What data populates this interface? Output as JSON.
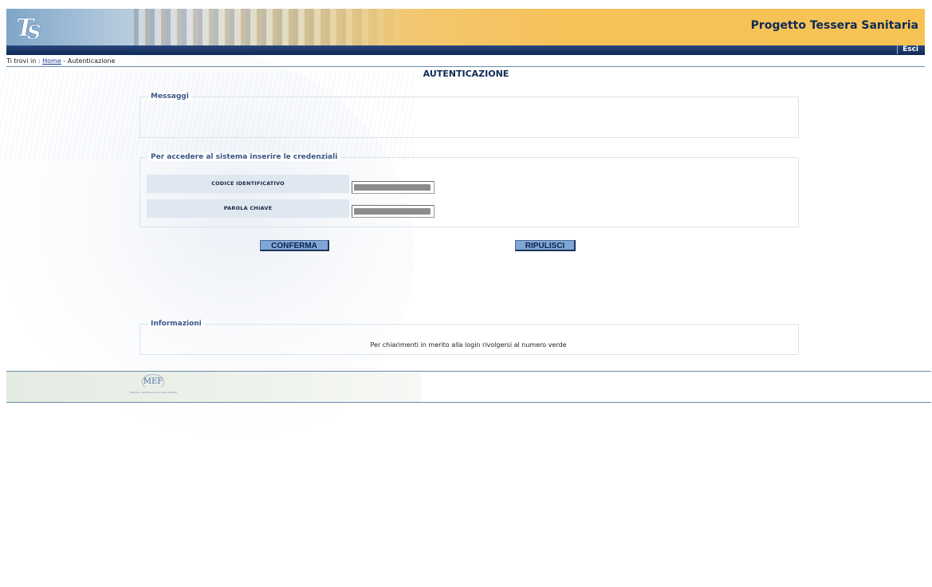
{
  "header": {
    "app_title": "Progetto Tessera Sanitaria",
    "logo_letters": "TS",
    "logout_label": "Esci"
  },
  "breadcrumb": {
    "prefix": "Ti trovi in : ",
    "home": "Home",
    "separator": " - ",
    "current": "Autenticazione"
  },
  "page_title": "AUTENTICAZIONE",
  "messages": {
    "legend": "Messaggi"
  },
  "credentials": {
    "legend": "Per accedere al sistema inserire le credenziali",
    "username_label": "Codice Identificativo",
    "password_label": "Parola Chiave"
  },
  "actions": {
    "confirm_label": "CONFERMA",
    "reset_label": "RIPULISCI"
  },
  "info": {
    "legend": "Informazioni",
    "text": "Per chiarimenti in merito alla login rivolgersi al numero verde"
  },
  "footer": {
    "logo_text": "MEF",
    "caption": "Ministero dell'Economia e delle Finanze"
  },
  "colors": {
    "navy": "#0f2a56",
    "accent_orange": "#f6c25a",
    "button_blue": "#7fa6d6",
    "label_bg": "#dfe7f1"
  }
}
